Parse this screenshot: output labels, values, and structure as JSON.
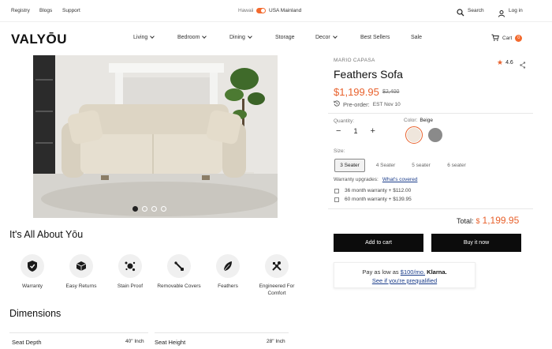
{
  "topbar": {
    "links": [
      "Registry",
      "Blogs",
      "Support"
    ],
    "region_label": "Hawaii",
    "region_value": "USA Mainland",
    "search_label": "Search",
    "login_label": "Log in"
  },
  "header": {
    "logo": "VALYŌU",
    "nav": [
      {
        "label": "Living",
        "dropdown": true
      },
      {
        "label": "Bedroom",
        "dropdown": true
      },
      {
        "label": "Dining",
        "dropdown": true
      },
      {
        "label": "Storage",
        "dropdown": false
      },
      {
        "label": "Decor",
        "dropdown": true
      },
      {
        "label": "Best Sellers",
        "dropdown": false
      },
      {
        "label": "Sale",
        "dropdown": false
      }
    ],
    "cart_label": "Cart",
    "cart_count": "0"
  },
  "gallery": {
    "slides": 4,
    "active": 0
  },
  "about": {
    "title": "It's All About Yōu",
    "features": [
      {
        "icon": "shield-icon",
        "label": "Warranty"
      },
      {
        "icon": "box-icon",
        "label": "Easy Returns"
      },
      {
        "icon": "splash-icon",
        "label": "Stain Proof"
      },
      {
        "icon": "zipper-icon",
        "label": "Removable Covers"
      },
      {
        "icon": "feather-icon",
        "label": "Feathers"
      },
      {
        "icon": "tools-icon",
        "label": "Engineered For Comfort"
      }
    ]
  },
  "dimensions": {
    "title": "Dimensions",
    "rows": [
      {
        "label": "Seat Depth",
        "value": "40\" Inch"
      },
      {
        "label": "Seat Height",
        "value": "28\" Inch"
      }
    ]
  },
  "product": {
    "brand": "MARIO CAPASA",
    "rating": "4.6",
    "title": "Feathers Sofa",
    "price": "$1,199.95",
    "old_price": "$2,400",
    "preorder_label": "Pre-order:",
    "preorder_date": "EST Nov 10",
    "quantity_label": "Quantity:",
    "quantity": "1",
    "color_label": "Color:",
    "color_value": "Beige",
    "colors": [
      "#efe6dc",
      "#8a8a8a"
    ],
    "size_label": "Size:",
    "sizes": [
      "3 Seater",
      "4 Seater",
      "5 seater",
      "6 seater"
    ],
    "selected_size": "3 Seater",
    "warranty_label": "Warranty upgrades:",
    "warranty_link": "What's covered",
    "warranties": [
      "36 month warranty + $112.00",
      "60 month warranty + $139.95"
    ],
    "total_label": "Total:",
    "total_currency": "$",
    "total_value": "1,199.95",
    "add_to_cart": "Add to cart",
    "buy_now": "Buy it now",
    "klarna_prefix": "Pay as low as",
    "klarna_amount": "$100/mo.",
    "klarna_brand": "Klarna.",
    "klarna_link": "See if you're prequalified"
  },
  "colors": {
    "accent": "#e8612c",
    "button": "#0c0c0c"
  }
}
